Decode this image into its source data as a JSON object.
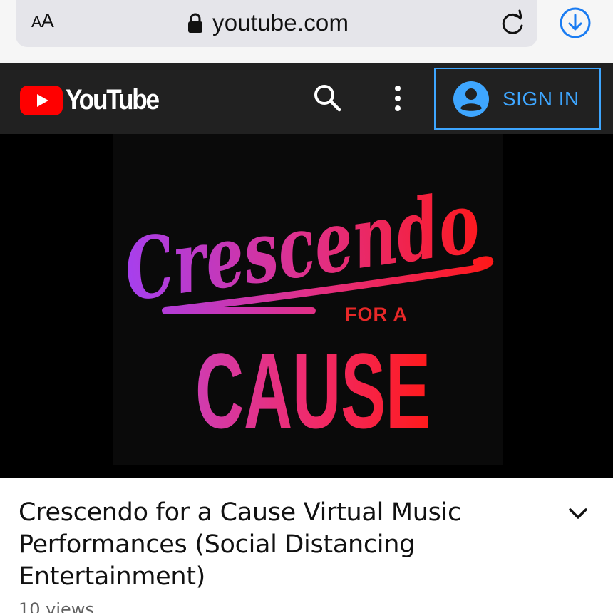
{
  "browser": {
    "reader_button": {
      "small": "A",
      "large": "A"
    },
    "url": "youtube.com",
    "icons": [
      "lock-icon",
      "reload-icon",
      "download-icon"
    ]
  },
  "header": {
    "logo_text": "YouTube",
    "sign_in_label": "SIGN IN",
    "icons": [
      "youtube-play-icon",
      "search-icon",
      "more-vertical-icon",
      "account-icon"
    ],
    "colors": {
      "header_bg": "#212121",
      "logo_red": "#ff0000",
      "sign_in_blue": "#3ea6ff"
    }
  },
  "thumbnail": {
    "script_word": "Crescendo",
    "small_line": "FOR A",
    "big_word": "CAUSE",
    "colors": {
      "gradient_start": "#a540f0",
      "gradient_mid": "#e0308a",
      "gradient_end": "#ff1818",
      "for_a": "#e82828"
    }
  },
  "video": {
    "title": "Crescendo for a Cause Virtual Music Performances (Social Distancing Entertainment)",
    "views": "10 views",
    "expand_icon": "chevron-down-icon"
  }
}
